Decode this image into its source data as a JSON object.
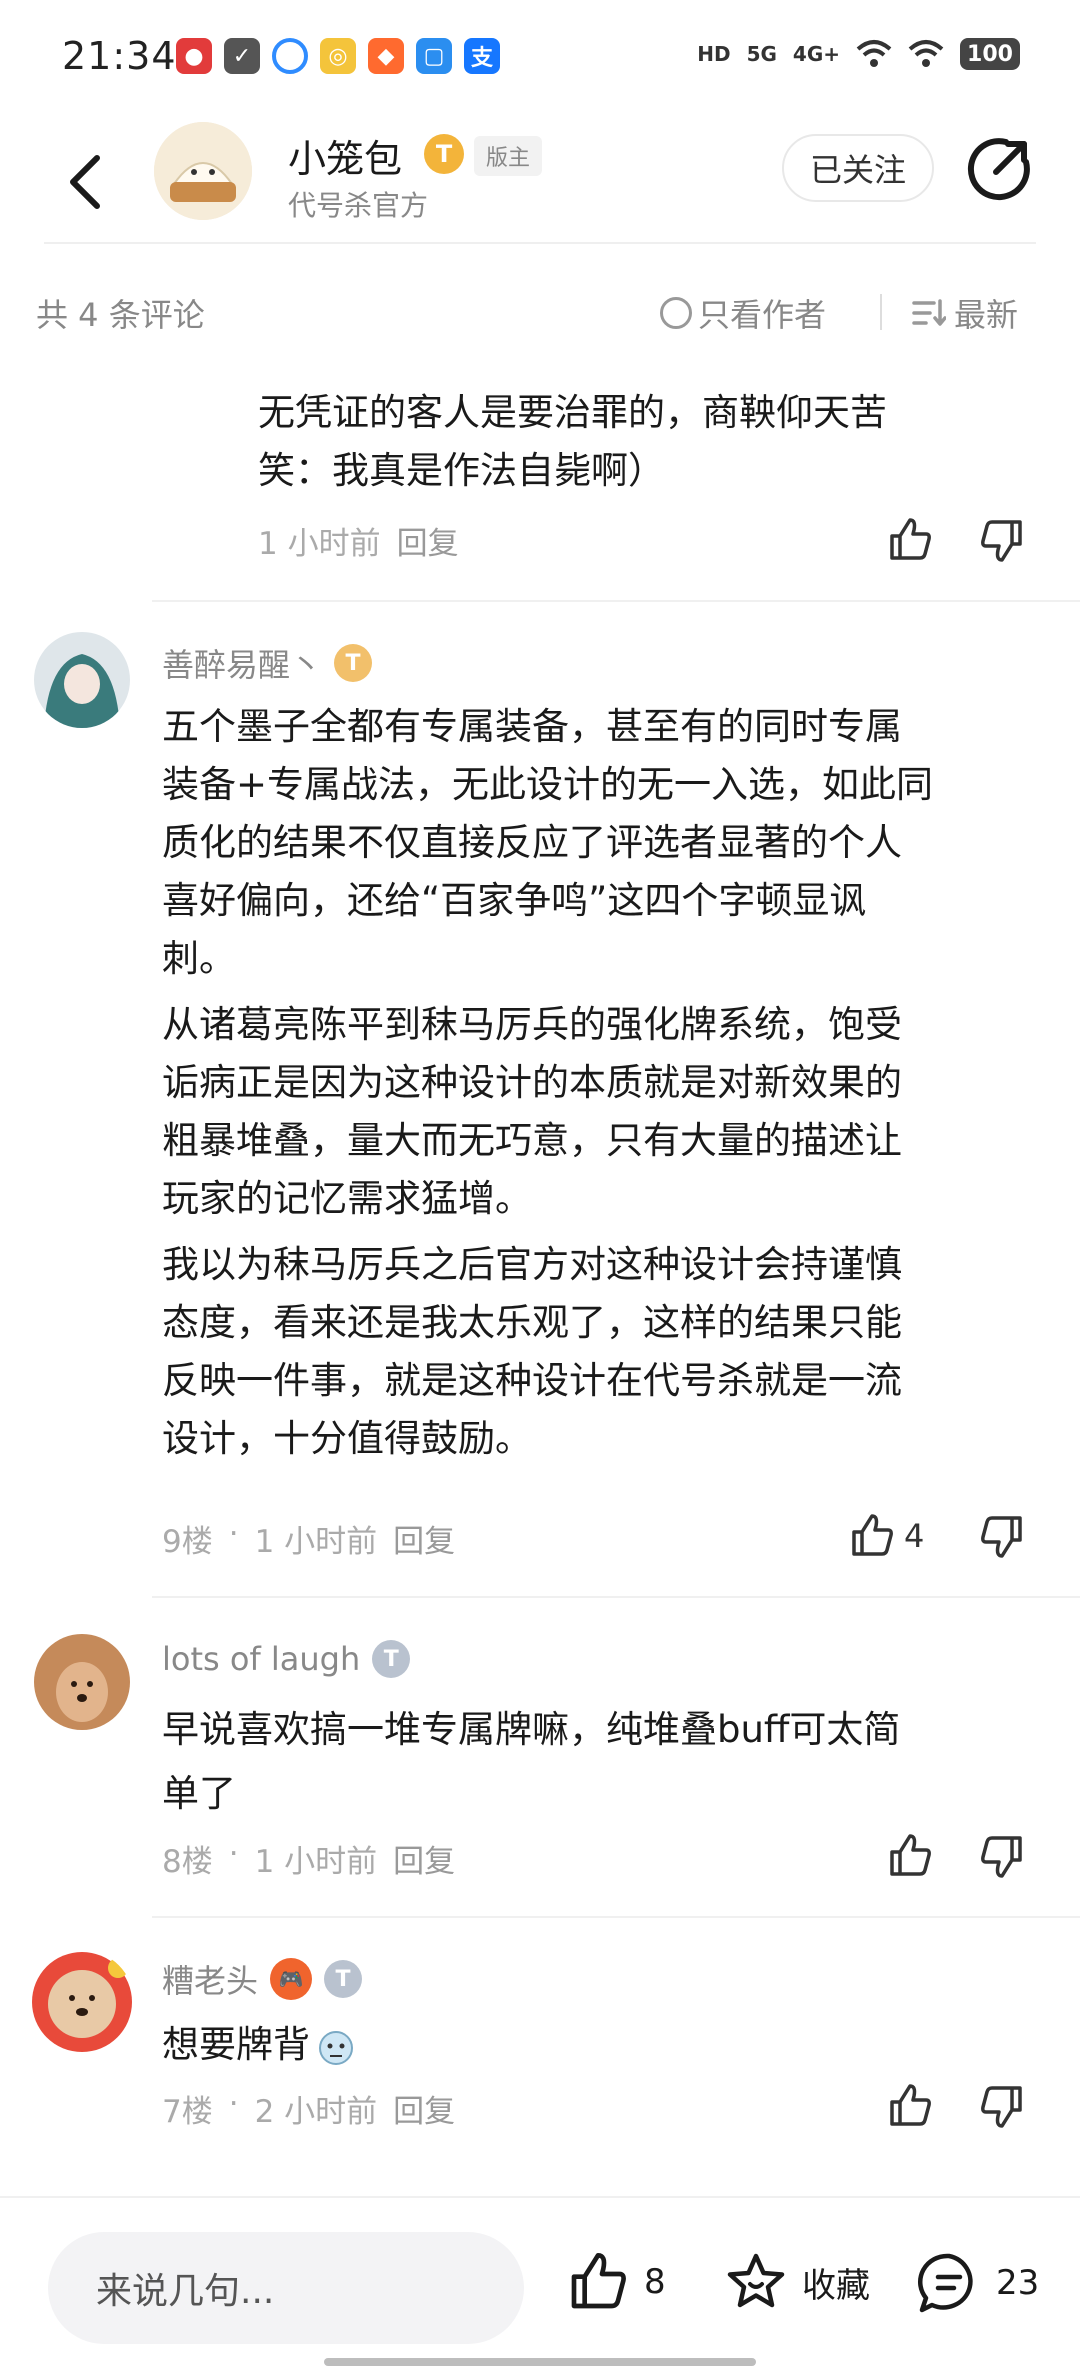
{
  "status_bar": {
    "time": "21:34",
    "network_hd": "HD",
    "network_5g": "5G",
    "network_4g": "4G+",
    "battery": "100"
  },
  "header": {
    "owner_name": "小笼包",
    "owner_level": "T",
    "owner_badge": "版主",
    "owner_subtitle": "代号杀官方",
    "follow_label": "已关注"
  },
  "filter": {
    "count_label": "共 4 条评论",
    "only_author_label": "只看作者",
    "sort_label": "最新"
  },
  "comments": [
    {
      "text_lines": [
        "无凭证的客人是要治罪的，商鞅仰天苦",
        "笑：我真是作法自毙啊）"
      ],
      "time": "1 小时前",
      "reply_label": "回复"
    },
    {
      "user": "善醉易醒丶",
      "level": "T",
      "paragraphs": [
        [
          "五个墨子全都有专属装备，甚至有的同时专属",
          "装备+专属战法，无此设计的无一入选，如此同",
          "质化的结果不仅直接反应了评选者显著的个人",
          "喜好偏向，还给“百家争鸣”这四个字顿显讽",
          "刺。"
        ],
        [
          "从诸葛亮陈平到秣马厉兵的强化牌系统，饱受",
          "诟病正是因为这种设计的本质就是对新效果的",
          "粗暴堆叠，量大而无巧意，只有大量的描述让",
          "玩家的记忆需求猛增。"
        ],
        [
          "我以为秣马厉兵之后官方对这种设计会持谨慎",
          "态度，看来还是我太乐观了，这样的结果只能",
          "反映一件事，就是这种设计在代号杀就是一流",
          "设计，十分值得鼓励。"
        ]
      ],
      "floor": "9楼",
      "time": "1 小时前",
      "reply_label": "回复",
      "likes": "4"
    },
    {
      "user": "lots of laugh",
      "level": "T",
      "text_lines": [
        "早说喜欢搞一堆专属牌嘛，纯堆叠buff可太简",
        "单了"
      ],
      "floor": "8楼",
      "time": "1 小时前",
      "reply_label": "回复"
    },
    {
      "user": "糟老头",
      "level": "T",
      "text": "想要牌背",
      "floor": "7楼",
      "time": "2 小时前",
      "reply_label": "回复"
    }
  ],
  "bottom_bar": {
    "input_placeholder": "来说几句...",
    "like_count": "8",
    "favorite_label": "收藏",
    "comment_count": "23"
  },
  "colors": {
    "accent_gold": "#f3b43a",
    "text_primary": "#1a1a1a",
    "text_secondary": "#888888",
    "divider": "#f0f0f0"
  },
  "icons": [
    "back-arrow-icon",
    "share-icon",
    "radio-icon",
    "sort-icon",
    "thumb-up-icon",
    "thumb-down-icon",
    "star-icon",
    "comment-icon"
  ]
}
